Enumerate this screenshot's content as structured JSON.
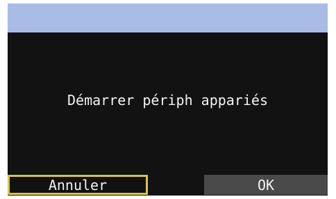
{
  "dialog": {
    "message": "Démarrer périph appariés"
  },
  "buttons": {
    "cancel_label": "Annuler",
    "ok_label": "OK"
  },
  "colors": {
    "title_bar": "#a9bce6",
    "background": "#121212",
    "selection_border": "#d6c44a",
    "ok_button": "#4a4a4a",
    "text": "#f2f2f2"
  }
}
